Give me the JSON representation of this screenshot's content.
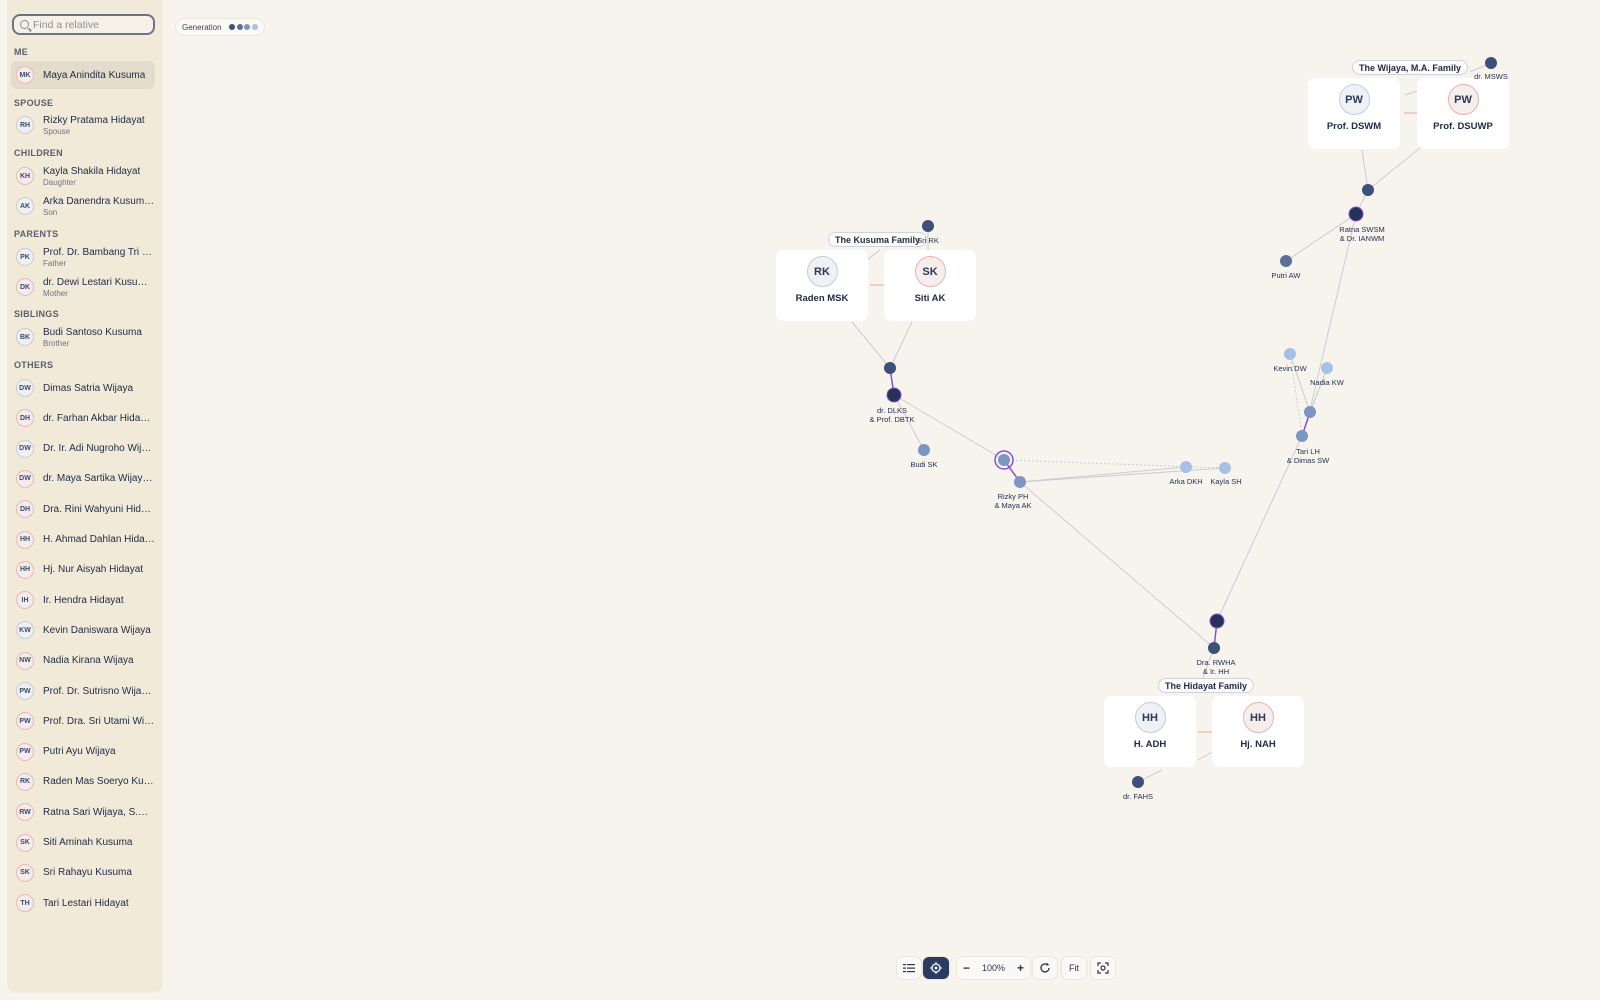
{
  "sidebar": {
    "search_placeholder": "Find a relative",
    "sections": {
      "me": "ME",
      "spouse": "SPOUSE",
      "children": "CHILDREN",
      "parents": "PARENTS",
      "siblings": "SIBLINGS",
      "others": "OTHERS"
    },
    "me": {
      "initials": "MK",
      "name": "Maya Anindita Kusuma"
    },
    "spouse": {
      "initials": "RH",
      "name": "Rizky Pratama Hidayat",
      "role": "Spouse"
    },
    "children": [
      {
        "initials": "KH",
        "name": "Kayla Shakila Hidayat",
        "role": "Daughter"
      },
      {
        "initials": "AK",
        "name": "Arka Danendra Kusuma H...",
        "role": "Son"
      }
    ],
    "parents": [
      {
        "initials": "PK",
        "name": "Prof. Dr. Bambang Tri Kus...",
        "role": "Father"
      },
      {
        "initials": "DK",
        "name": "dr. Dewi Lestari Kusuma,...",
        "role": "Mother"
      }
    ],
    "siblings": [
      {
        "initials": "BK",
        "name": "Budi Santoso Kusuma",
        "role": "Brother"
      }
    ],
    "others": [
      {
        "initials": "DW",
        "name": "Dimas Satria Wijaya"
      },
      {
        "initials": "DH",
        "name": "dr. Farhan Akbar Hidayat,..."
      },
      {
        "initials": "DW",
        "name": "Dr. Ir. Adi Nugroho Wijaya..."
      },
      {
        "initials": "DW",
        "name": "dr. Maya Sartika Wijaya, S..."
      },
      {
        "initials": "DH",
        "name": "Dra. Rini Wahyuni Hidayat..."
      },
      {
        "initials": "HH",
        "name": "H. Ahmad Dahlan Hidayat"
      },
      {
        "initials": "HH",
        "name": "Hj. Nur Aisyah Hidayat"
      },
      {
        "initials": "IH",
        "name": "Ir. Hendra Hidayat"
      },
      {
        "initials": "KW",
        "name": "Kevin Daniswara Wijaya"
      },
      {
        "initials": "NW",
        "name": "Nadia Kirana Wijaya"
      },
      {
        "initials": "PW",
        "name": "Prof. Dr. Sutrisno Wijaya,..."
      },
      {
        "initials": "PW",
        "name": "Prof. Dra. Sri Utami Wijay..."
      },
      {
        "initials": "PW",
        "name": "Putri Ayu Wijaya"
      },
      {
        "initials": "RK",
        "name": "Raden Mas Soeryo Kusuma"
      },
      {
        "initials": "RW",
        "name": "Ratna Sari Wijaya, S.H.,..."
      },
      {
        "initials": "SK",
        "name": "Siti Aminah Kusuma"
      },
      {
        "initials": "SK",
        "name": "Sri Rahayu Kusuma"
      },
      {
        "initials": "TH",
        "name": "Tari Lestari Hidayat"
      }
    ]
  },
  "generation": {
    "label": "Generation",
    "colors": [
      "#3d4f7a",
      "#5b6f9c",
      "#7d95c3",
      "#a9c0e6"
    ]
  },
  "families": {
    "wijaya": "The Wijaya, M.A. Family",
    "kusuma": "The Kusuma Family",
    "hidayat": "The Hidayat Family"
  },
  "cards": {
    "prof_dswm": {
      "initials": "PW",
      "name": "Prof. DSWM"
    },
    "prof_dsuwp": {
      "initials": "PW",
      "name": "Prof. DSUWP"
    },
    "raden_msk": {
      "initials": "RK",
      "name": "Raden MSK"
    },
    "siti_ak": {
      "initials": "SK",
      "name": "Siti AK"
    },
    "h_adh": {
      "initials": "HH",
      "name": "H. ADH"
    },
    "hj_nah": {
      "initials": "HH",
      "name": "Hj. NAH"
    }
  },
  "nodes": {
    "dr_msws": "dr. MSWS",
    "sri_rk": "Sri RK",
    "ratna_l1": "Ratna SWSM",
    "ratna_l2": "& Dr. IANWM",
    "putri_aw": "Putri AW",
    "kevin_dw": "Kevin DW",
    "nadia_kw": "Nadia KW",
    "tari_l1": "Tari LH",
    "tari_l2": "& Dimas SW",
    "dlks_l1": "dr. DLKS",
    "dlks_l2": "& Prof. DBTK",
    "budi_sk": "Budi SK",
    "rizky_l1": "Rizky PH",
    "rizky_l2": "& Maya AK",
    "arka_dkh": "Arka DKH",
    "kayla_sh": "Kayla SH",
    "rwha_l1": "Dra. RWHA",
    "rwha_l2": "& Ir. HH",
    "dr_fahs": "dr. FAHS"
  },
  "toolbar": {
    "zoom": "100%",
    "fit": "Fit",
    "minus": "−",
    "plus": "+"
  },
  "colors": {
    "accent": "#2c3a5f",
    "highlight": "#8a4fd1",
    "spouse_line": "#e2a6a2"
  }
}
